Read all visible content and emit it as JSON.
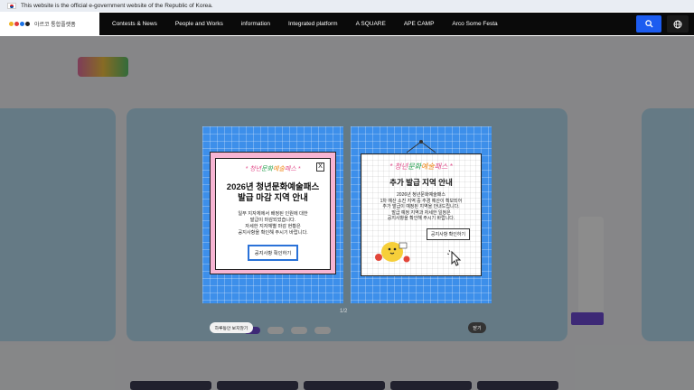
{
  "gov_banner": {
    "text": "This website is the official e-government website of the Republic of Korea."
  },
  "topnav": {
    "logo_text": "아르코 통합플랫폼",
    "menu": [
      "Contests & News",
      "People and Works",
      "information",
      "Integrated platform",
      "A SQUARE",
      "APE CAMP",
      "Arco Some Festa"
    ]
  },
  "popups": [
    {
      "title_line1": "2026년 청년문화예술패스",
      "title_line2": "발급 마감 지역 안내",
      "body": [
        "일부 지자체에서 배정된 인원에 대한",
        "발급이 마감되었습니다.",
        "자세한 지자체별 마감 현황은",
        "공지사항을 확인해 주시기 바랍니다."
      ],
      "button": "공지사항 확인하기",
      "close_label": "X"
    },
    {
      "title": "추가 발급 지역 안내",
      "body": [
        "2026년 청년문화예술패스",
        "1차 예산 소진 지역 중 추경 예산이 확보되어",
        "추가 발급이 예정된 지역을 안내드립니다.",
        "발급 예정 지역과 자세한 일정은",
        "공지사항을 확인해 주시기 바랍니다."
      ],
      "button": "공지사항 확인하기"
    }
  ],
  "pager": "1/2",
  "hide_today": "하루동안 보지않기",
  "close_all": "닫기",
  "colors": {
    "popup_bg": "#3d8fea",
    "card_pink": "#f7b5d3",
    "nav_bg": "#0a0a0a",
    "search_btn": "#1c5cf0"
  }
}
